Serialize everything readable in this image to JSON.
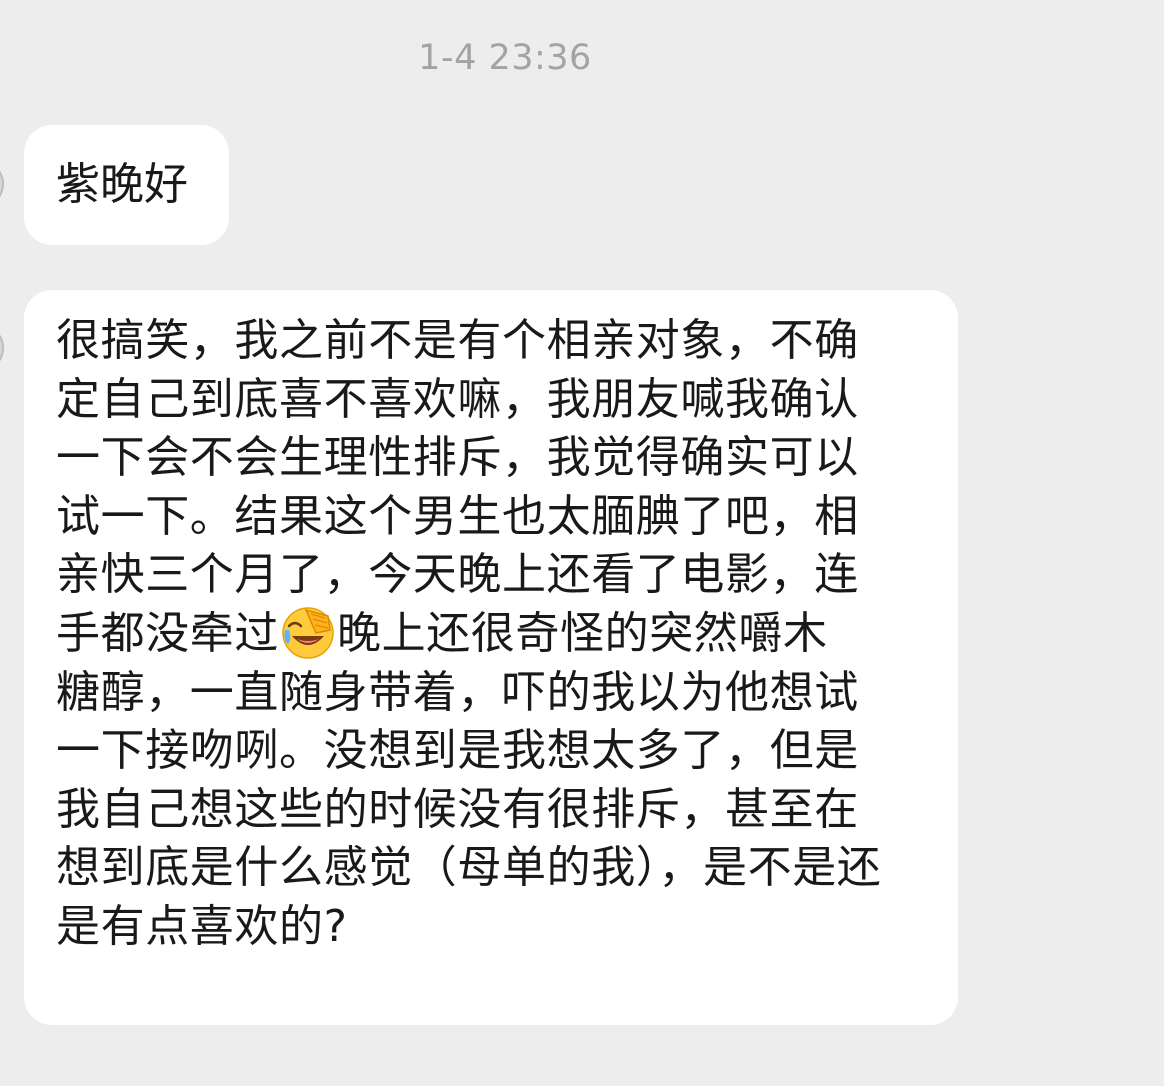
{
  "chat": {
    "timestamp": "1-4 23:36",
    "messages": [
      {
        "text": "紫晚好"
      },
      {
        "lines": [
          "很搞笑，我之前不是有个相亲对象，不确",
          "定自己到底喜不喜欢嘛，我朋友喊我确认",
          "一下会不会生理性排斥，我觉得确实可以",
          "试一下。结果这个男生也太腼腆了吧，相",
          "亲快三个月了，今天晚上还看了电影，连",
          "手都没牵过",
          "晚上还很奇怪的突然嚼木",
          "糖醇，一直随身带着，吓的我以为他想试",
          "一下接吻咧。没想到是我想太多了，但是",
          "我自己想这些的时候没有很排斥，甚至在",
          "想到底是什么感觉（母单的我），是不是还",
          "是有点喜欢的?"
        ],
        "emoji": "facepalm-laughing-emoji"
      }
    ]
  },
  "colors": {
    "background": "#ededed",
    "bubble": "#ffffff",
    "text": "#191919",
    "timestamp": "#a3a3a3"
  }
}
